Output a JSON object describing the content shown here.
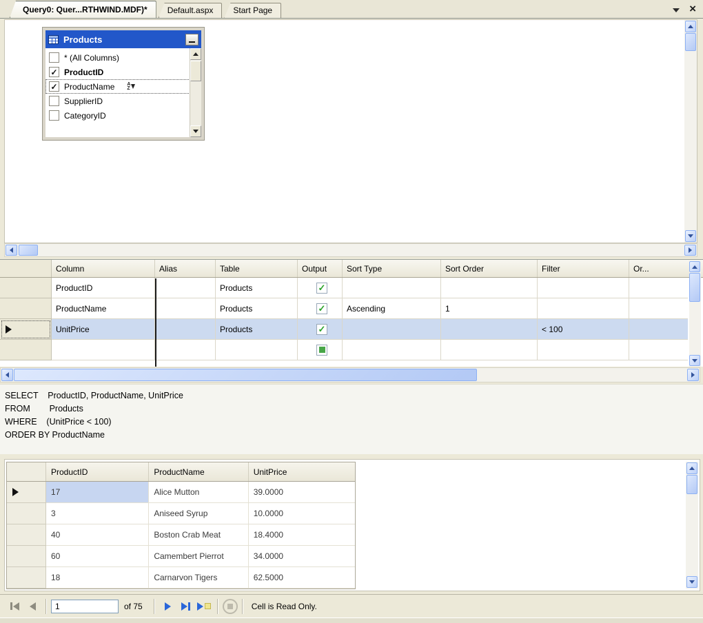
{
  "tab_bar": {
    "tabs": [
      {
        "label": "Query0: Quer...RTHWIND.MDF)*"
      },
      {
        "label": "Default.aspx"
      },
      {
        "label": "Start Page"
      }
    ]
  },
  "diagram_pane": {
    "table_window": {
      "title": "Products",
      "fields": [
        {
          "name": "* (All Columns)"
        },
        {
          "name": "ProductID"
        },
        {
          "name": "ProductName"
        },
        {
          "name": "SupplierID"
        },
        {
          "name": "CategoryID"
        }
      ]
    }
  },
  "criteria_grid": {
    "headers": [
      "Column",
      "Alias",
      "Table",
      "Output",
      "Sort Type",
      "Sort Order",
      "Filter",
      "Or..."
    ],
    "rows": [
      {
        "column": "ProductID",
        "alias": "",
        "table": "Products",
        "sort_type": "",
        "sort_order": "",
        "filter": "",
        "or": ""
      },
      {
        "column": "ProductName",
        "alias": "",
        "table": "Products",
        "sort_type": "Ascending",
        "sort_order": "1",
        "filter": "",
        "or": ""
      },
      {
        "column": "UnitPrice",
        "alias": "",
        "table": "Products",
        "sort_type": "",
        "sort_order": "",
        "filter": "< 100",
        "or": ""
      },
      {
        "column": "",
        "alias": "",
        "table": "",
        "sort_type": "",
        "sort_order": "",
        "filter": "",
        "or": ""
      }
    ]
  },
  "sql_pane": {
    "lines": [
      "SELECT    ProductID, ProductName, UnitPrice",
      "FROM        Products",
      "WHERE    (UnitPrice < 100)",
      "ORDER BY ProductName"
    ]
  },
  "results_grid": {
    "headers": [
      "ProductID",
      "ProductName",
      "UnitPrice"
    ],
    "rows": [
      [
        "17",
        "Alice Mutton",
        "39.0000"
      ],
      [
        "3",
        "Aniseed Syrup",
        "10.0000"
      ],
      [
        "40",
        "Boston Crab Meat",
        "18.4000"
      ],
      [
        "60",
        "Camembert Pierrot",
        "34.0000"
      ],
      [
        "18",
        "Carnarvon Tigers",
        "62.5000"
      ]
    ]
  },
  "record_navigator": {
    "current_record": "1",
    "record_count_label": "of 75",
    "status_text": "Cell is Read Only."
  },
  "colors": {
    "title_bar_blue": "#2257c9",
    "selection_blue": "#ccdaf0",
    "check_green": "#2ba32b",
    "scrollbar_blue": "#bcd0f8",
    "background_beige": "#ece9d8"
  }
}
